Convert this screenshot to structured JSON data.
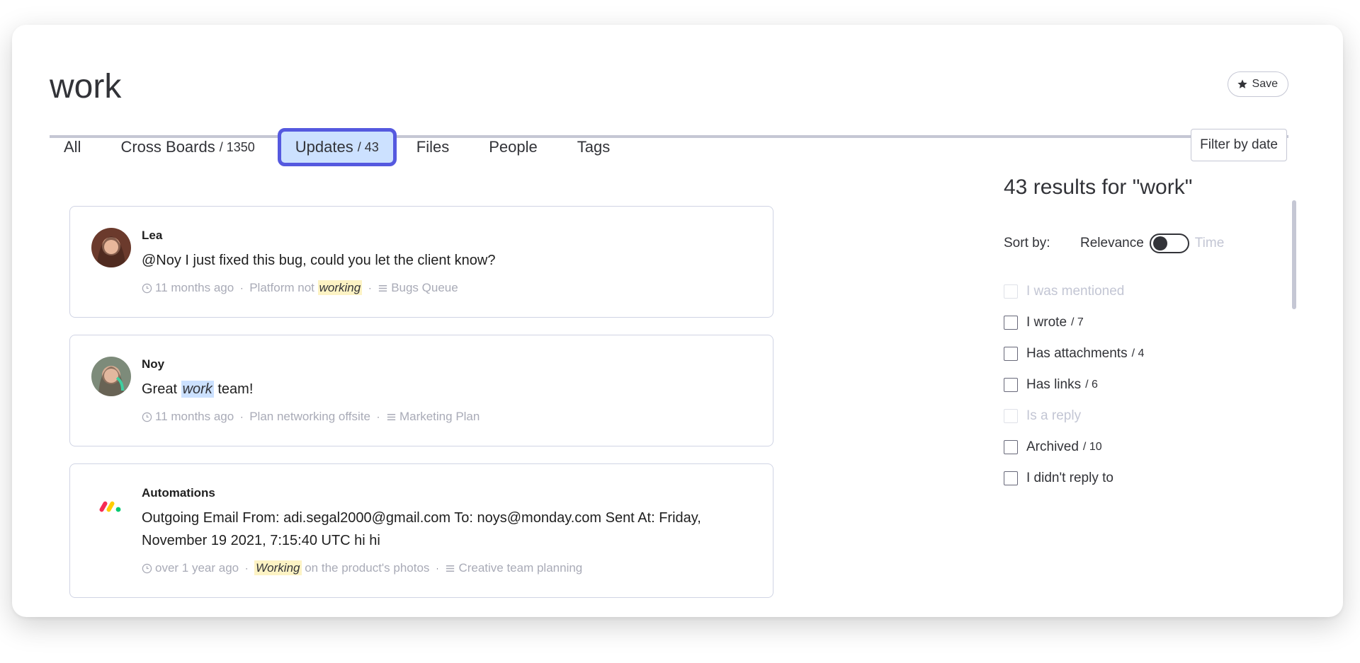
{
  "search": {
    "query": "work",
    "save_label": "Save"
  },
  "tabs": [
    {
      "label": "All",
      "count": ""
    },
    {
      "label": "Cross Boards",
      "count": "/ 1350"
    },
    {
      "label": "Updates",
      "count": "/ 43",
      "active": true
    },
    {
      "label": "Files",
      "count": ""
    },
    {
      "label": "People",
      "count": ""
    },
    {
      "label": "Tags",
      "count": ""
    }
  ],
  "filter_by_date": "Filter by date",
  "updates": [
    {
      "author": "Lea",
      "body_pre": "@Noy I just fixed this bug, could you let the client know?",
      "time": "11 months ago",
      "item_pre": "Platform not ",
      "item_hl": "working",
      "item_post": "",
      "board": "Bugs Queue"
    },
    {
      "author": "Noy",
      "body_pre": "Great ",
      "body_hl": "work",
      "body_post": " team!",
      "time": "11 months ago",
      "item_pre": "Plan networking offsite",
      "board": "Marketing Plan"
    },
    {
      "author": "Automations",
      "body_pre": "Outgoing Email From: adi.segal2000@gmail.com To: noys@monday.com Sent At: Friday, November 19 2021, 7:15:40 UTC hi hi",
      "time": "over 1 year ago",
      "item_hl": "Working",
      "item_post": " on the product's photos",
      "board": "Creative team planning"
    }
  ],
  "sidebar": {
    "results_title": "43 results for \"work\"",
    "sort_label": "Sort by:",
    "sort_relevance": "Relevance",
    "sort_time": "Time",
    "filters": [
      {
        "label": "I was mentioned",
        "count": "",
        "disabled": true
      },
      {
        "label": "I wrote",
        "count": "/ 7",
        "disabled": false
      },
      {
        "label": "Has attachments",
        "count": "/ 4",
        "disabled": false
      },
      {
        "label": "Has links",
        "count": "/ 6",
        "disabled": false
      },
      {
        "label": "Is a reply",
        "count": "",
        "disabled": true
      },
      {
        "label": "Archived",
        "count": "/ 10",
        "disabled": false
      },
      {
        "label": "I didn't reply to",
        "count": "",
        "disabled": false
      }
    ]
  },
  "colors": {
    "active_tab_bg": "#cce1ff",
    "active_tab_border": "#5559df",
    "highlight_yellow": "#fdf3c4",
    "highlight_blue": "#cce1ff"
  }
}
